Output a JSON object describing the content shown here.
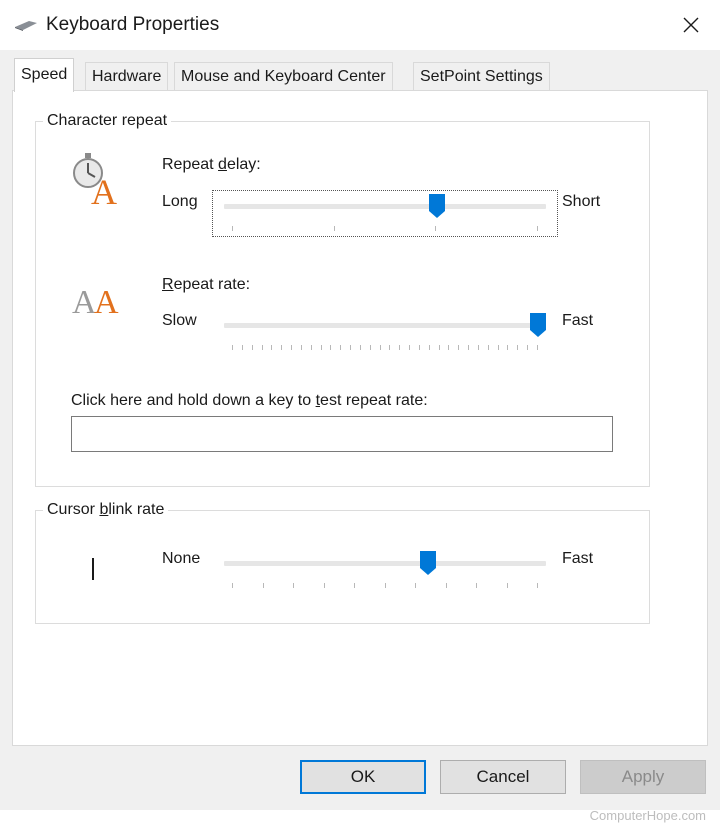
{
  "window": {
    "title": "Keyboard Properties",
    "icon": "keyboard-icon",
    "close_icon": "close-icon"
  },
  "tabs": [
    {
      "label": "Speed",
      "active": true
    },
    {
      "label": "Hardware",
      "active": false
    },
    {
      "label": "Mouse and Keyboard Center",
      "active": false
    },
    {
      "label": "SetPoint Settings",
      "active": false
    }
  ],
  "character_repeat": {
    "legend": "Character repeat",
    "repeat_delay": {
      "label_pre": "Repeat ",
      "label_accel": "d",
      "label_post": "elay:",
      "min_label": "Long",
      "max_label": "Short",
      "icon": "stopwatch-letter-a-icon",
      "value_fraction": 0.67
    },
    "repeat_rate": {
      "label_accel": "R",
      "label_post": "epeat rate:",
      "min_label": "Slow",
      "max_label": "Fast",
      "icon": "double-letter-a-icon",
      "value_fraction": 1.0
    },
    "test": {
      "label_pre": "Click here and hold down a key to ",
      "label_accel": "t",
      "label_post": "est repeat rate:",
      "value": ""
    }
  },
  "cursor_blink": {
    "legend_pre": "Cursor ",
    "legend_accel": "b",
    "legend_post": "link rate",
    "min_label": "None",
    "max_label": "Fast",
    "icon": "text-cursor-icon",
    "value_fraction": 0.64
  },
  "buttons": {
    "ok": "OK",
    "cancel": "Cancel",
    "apply": "Apply"
  },
  "watermark": "ComputerHope.com",
  "colors": {
    "accent": "#0078d7",
    "window_bg": "#f0f0f0",
    "panel_bg": "#ffffff",
    "icon_orange": "#e2711d"
  }
}
